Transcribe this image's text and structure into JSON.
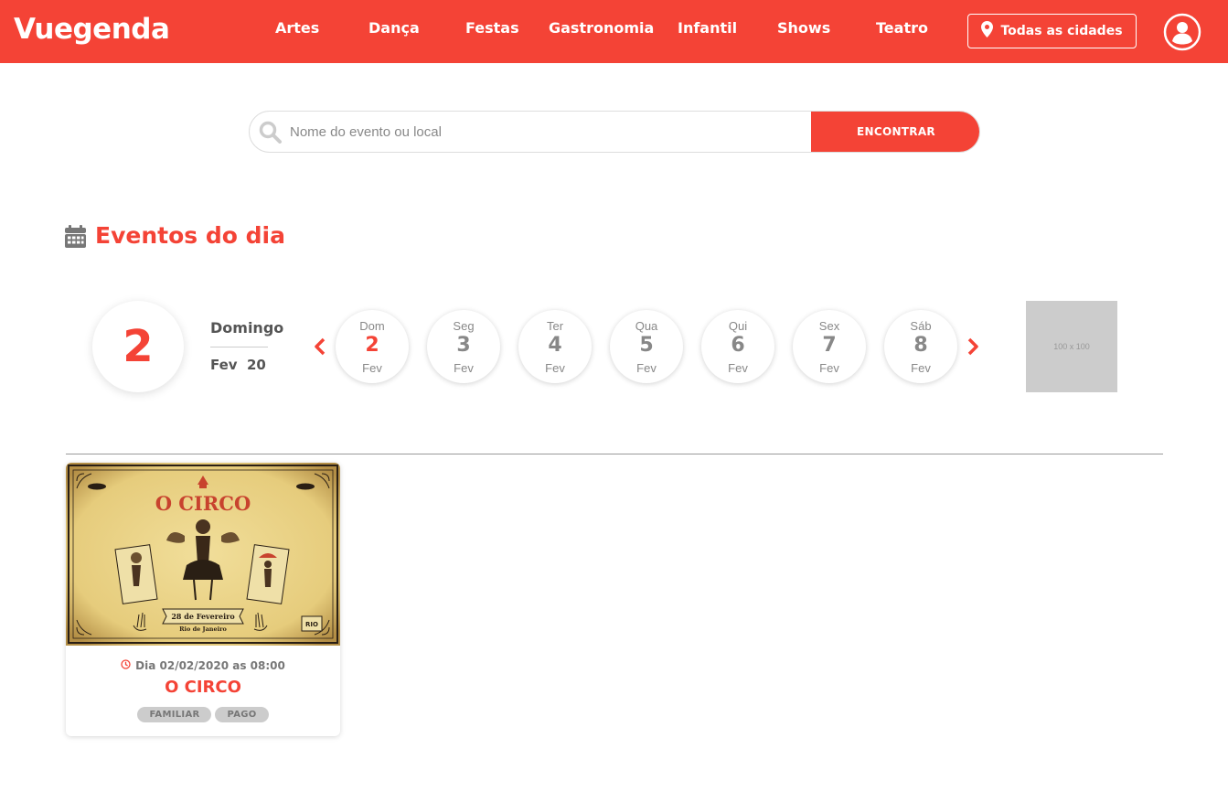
{
  "brand": {
    "name": "Vuegenda",
    "accent": "#f44336"
  },
  "nav": {
    "items": [
      {
        "label": "Artes"
      },
      {
        "label": "Dança"
      },
      {
        "label": "Festas"
      },
      {
        "label": "Gastronomia"
      },
      {
        "label": "Infantil"
      },
      {
        "label": "Shows"
      },
      {
        "label": "Teatro"
      }
    ],
    "city_button": {
      "label": "Todas as cidades",
      "icon": "map-pin-icon"
    },
    "user_icon": "user-circle-icon"
  },
  "search": {
    "placeholder": "Nome do evento ou local",
    "value": "",
    "button_label": "ENCONTRAR",
    "icon": "search-icon"
  },
  "section": {
    "title": "Eventos do dia",
    "icon": "calendar-icon"
  },
  "current_date": {
    "day": "2",
    "weekday": "Domingo",
    "month": "Fev",
    "year": "20"
  },
  "days": [
    {
      "weekday": "Dom",
      "day": "2",
      "month": "Fev",
      "active": true
    },
    {
      "weekday": "Seg",
      "day": "3",
      "month": "Fev",
      "active": false
    },
    {
      "weekday": "Ter",
      "day": "4",
      "month": "Fev",
      "active": false
    },
    {
      "weekday": "Qua",
      "day": "5",
      "month": "Fev",
      "active": false
    },
    {
      "weekday": "Qui",
      "day": "6",
      "month": "Fev",
      "active": false
    },
    {
      "weekday": "Sex",
      "day": "7",
      "month": "Fev",
      "active": false
    },
    {
      "weekday": "Sáb",
      "day": "8",
      "month": "Fev",
      "active": false
    }
  ],
  "ad": {
    "label": "100 x 100"
  },
  "events": [
    {
      "title": "O CIRCO",
      "datetime": "Dia 02/02/2020 as 08:00",
      "tags": [
        "FAMILIAR",
        "PAGO"
      ],
      "poster": {
        "title": "O CIRCO",
        "date_line": "28 de Fevereiro",
        "place_line": "Rio de Janeiro",
        "logo": "RIO"
      }
    }
  ]
}
